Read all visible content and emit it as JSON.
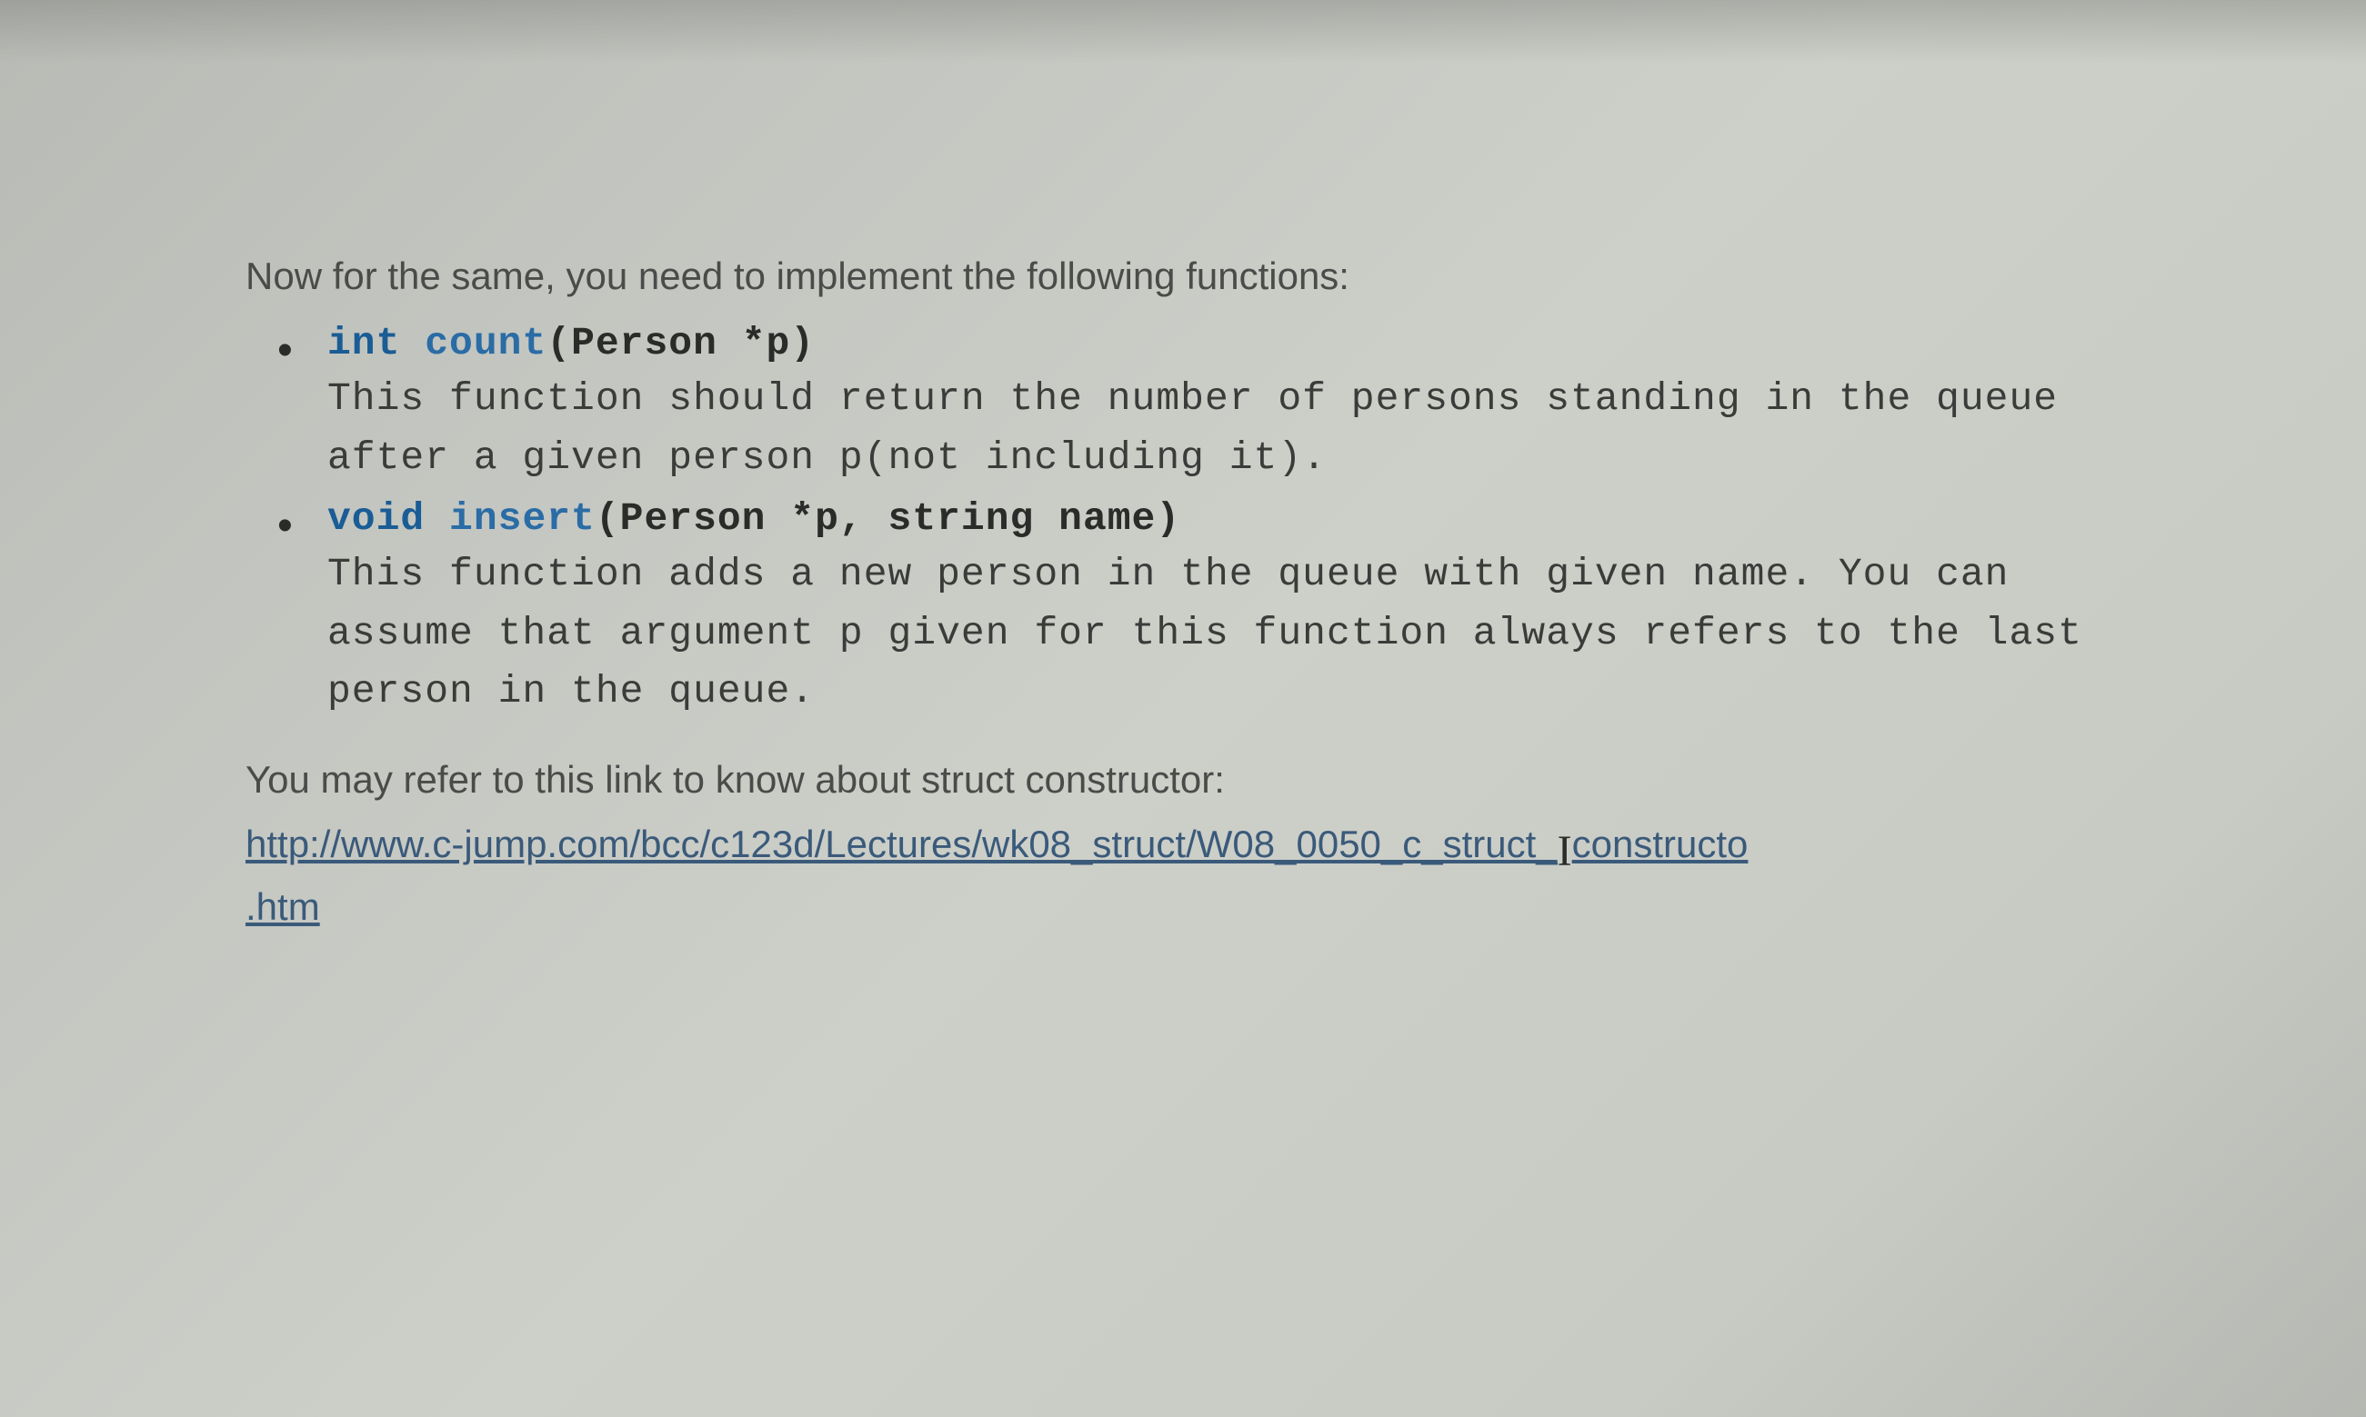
{
  "intro": "Now for the same, you need to implement the following functions:",
  "functions": [
    {
      "return_type": "int",
      "name": "count",
      "params": "(Person *p)",
      "description": "This function should return the number of persons standing in the queue after a given person p(not including it)."
    },
    {
      "return_type": "void",
      "name": "insert",
      "params": "(Person *p, string name)",
      "description": "This function adds a new person in the queue with given name. You can assume that argument p given for this function always refers to the last person in the queue."
    }
  ],
  "refer_text": "You may refer to this link to know about struct constructor:",
  "link_part1": "http://www.c-jump.com/bcc/c123d/Lectures/wk08_struct/W08_0050_c_struct_",
  "link_part2": "constructo",
  "link_part3": ".htm"
}
